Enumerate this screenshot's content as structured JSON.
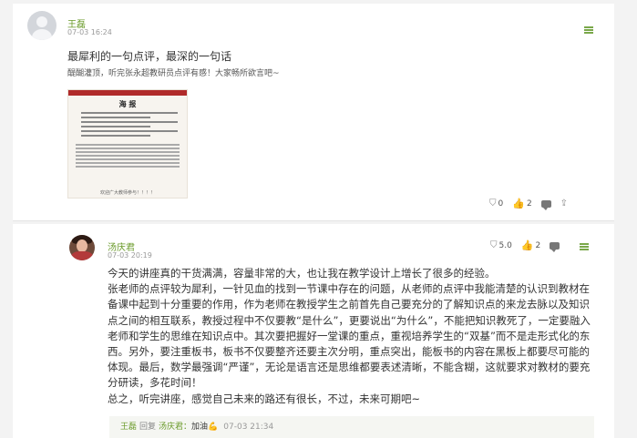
{
  "posts": [
    {
      "user": "王磊",
      "time": "07-03 16:24",
      "title": "最犀利的一句点评，最深的一句话",
      "text": "醍醐灌顶，听完张永超教研员点评有感！大家畅所欲言吧~",
      "poster": {
        "heading": "海  报",
        "footer": "欢迎广大教师参与！！！！"
      },
      "actions": {
        "rating": "0",
        "likes": "2"
      }
    },
    {
      "user": "汤庆君",
      "time": "07-03 20:19",
      "actions": {
        "rating": "5.0",
        "likes": "2"
      },
      "comment": "今天的讲座真的干货满满，容量非常的大，也让我在教学设计上增长了很多的经验。\n张老师的点评较为犀利，一针见血的找到一节课中存在的问题，从老师的点评中我能清楚的认识到教材在备课中起到十分重要的作用，作为老师在教授学生之前首先自己要充分的了解知识点的来龙去脉以及知识点之间的相互联系，教授过程中不仅要教“是什么”，更要说出“为什么”，不能把知识教死了，一定要融入老师和学生的思维在知识点中。其次要把握好一堂课的重点，重视培养学生的“双基”而不是走形式化的东西。另外，要注重板书，板书不仅要整齐还要主次分明，重点突出，能板书的内容在黑板上都要尽可能的体现。最后，数学最强调“严谨”，无论是语言还是思维都要表述清晰，不能含糊，这就要求对教材的要充分研读，多花时间！\n总之，听完讲座，感觉自己未来的路还有很长，不过，未来可期吧~",
      "reply": {
        "user": "王磊",
        "verb": "回复",
        "target": "汤庆君：",
        "text": "加油💪",
        "time": "07-03 21:34"
      }
    }
  ],
  "icons": {
    "menu": "menu-icon",
    "rating": "award-icon",
    "like": "thumbs-up-icon",
    "comment": "comment-icon",
    "share": "share-icon"
  },
  "colors": {
    "accent": "#6a9a2a",
    "text": "#333333",
    "muted": "#9a9a9a",
    "background": "#f3f3f3"
  }
}
